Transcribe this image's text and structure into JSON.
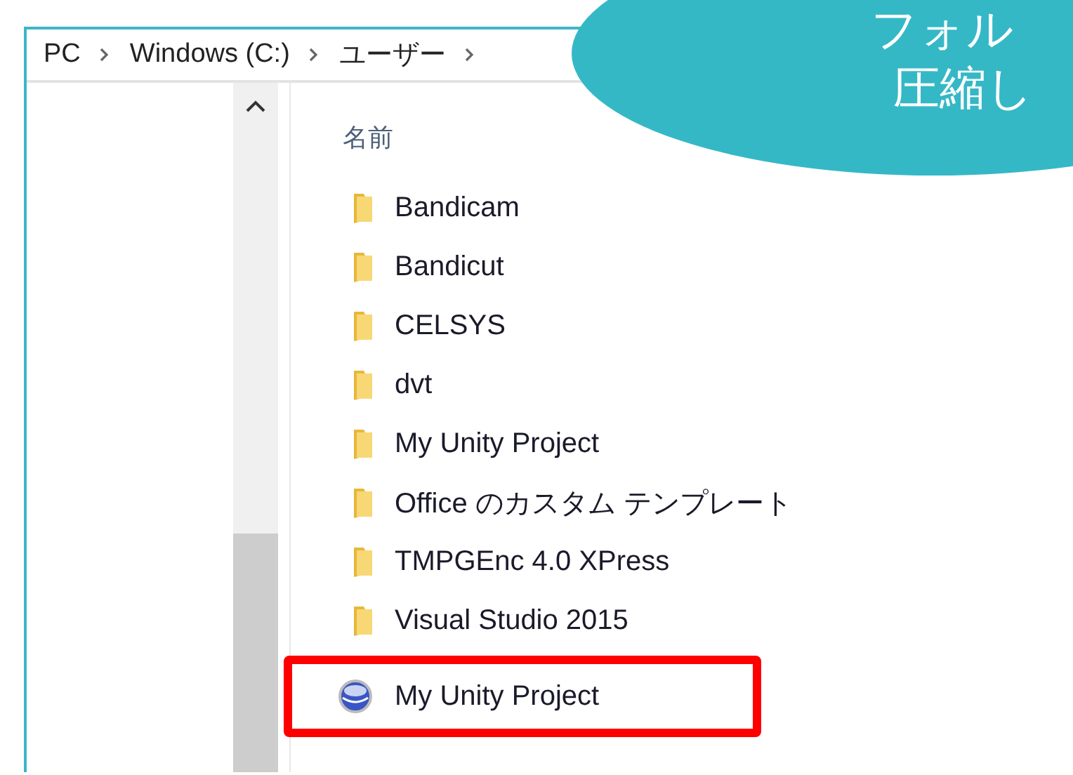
{
  "breadcrumb": [
    {
      "label": "PC"
    },
    {
      "label": "Windows (C:)"
    },
    {
      "label": "ユーザー"
    }
  ],
  "column_header": "名前",
  "files": [
    {
      "name": "Bandicam",
      "kind": "folder",
      "highlighted": false
    },
    {
      "name": "Bandicut",
      "kind": "folder",
      "highlighted": false
    },
    {
      "name": "CELSYS",
      "kind": "folder",
      "highlighted": false
    },
    {
      "name": "dvt",
      "kind": "folder",
      "highlighted": false
    },
    {
      "name": "My Unity Project",
      "kind": "folder",
      "highlighted": false
    },
    {
      "name": "Office のカスタム テンプレート",
      "kind": "folder",
      "highlighted": false
    },
    {
      "name": "TMPGEnc 4.0 XPress",
      "kind": "folder",
      "highlighted": false
    },
    {
      "name": "Visual Studio 2015",
      "kind": "folder",
      "highlighted": false
    },
    {
      "name": "My Unity Project",
      "kind": "zip",
      "highlighted": true
    }
  ],
  "callout": {
    "lines": [
      "フォル",
      "圧縮し"
    ]
  }
}
